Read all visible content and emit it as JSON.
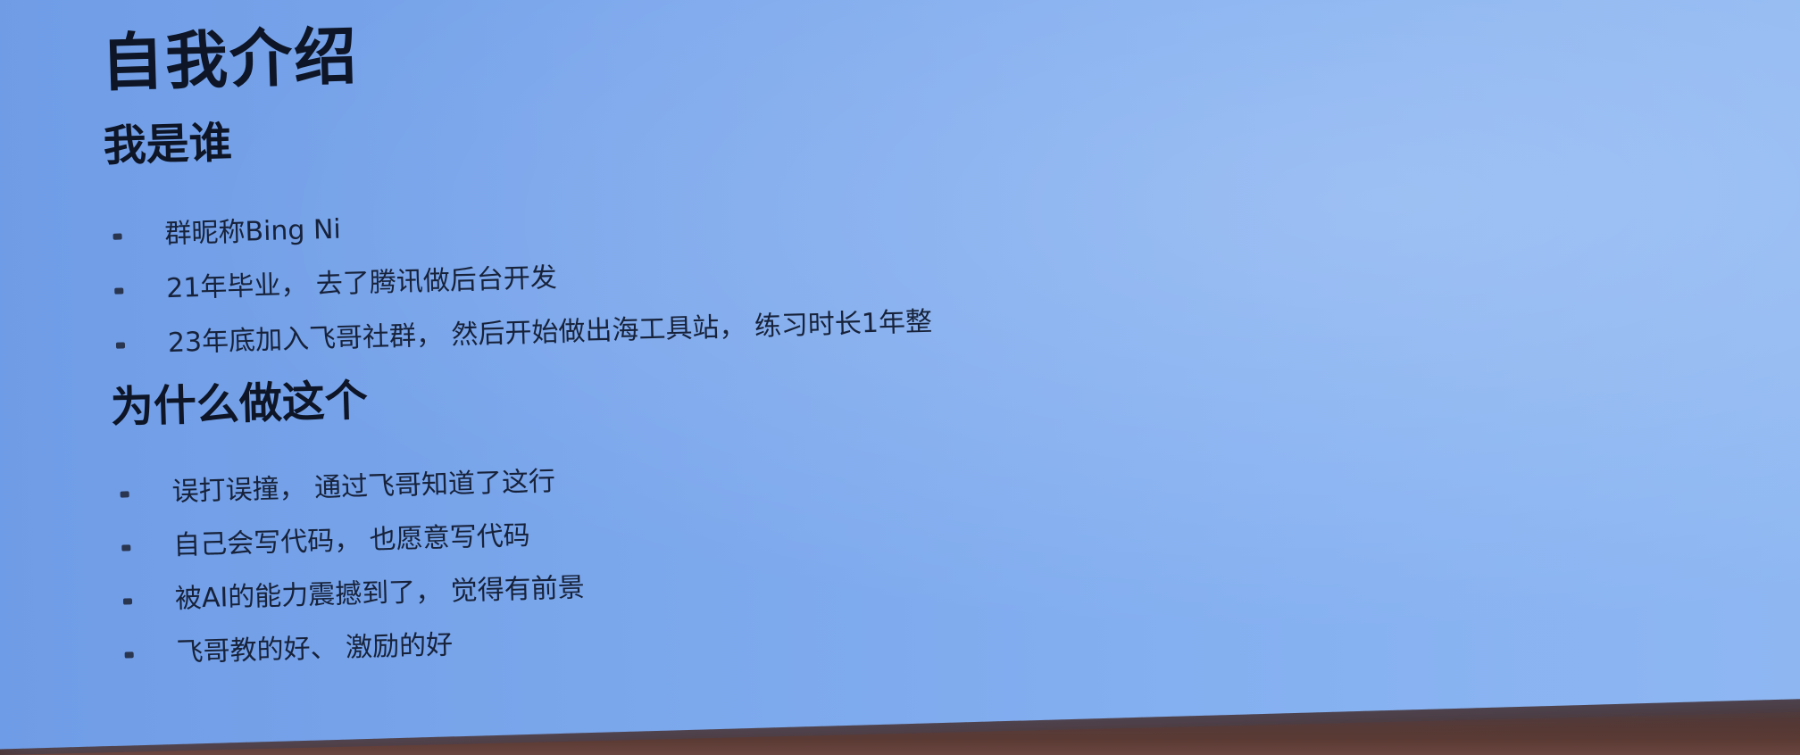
{
  "slide": {
    "title": "自我介绍",
    "sections": [
      {
        "heading": "我是谁",
        "bullets": [
          "群昵称Bing Ni",
          "21年毕业， 去了腾讯做后台开发",
          "23年底加入飞哥社群， 然后开始做出海工具站， 练习时长1年整"
        ]
      },
      {
        "heading": "为什么做这个",
        "bullets": [
          "误打误撞， 通过飞哥知道了这行",
          "自己会写代码， 也愿意写代码",
          "被AI的能力震撼到了， 觉得有前景",
          "飞哥教的好、 激励的好"
        ]
      }
    ]
  },
  "colors": {
    "slide_background": "#7ba7ec",
    "text": "#0d1526",
    "frame": "#2b2a2c"
  }
}
